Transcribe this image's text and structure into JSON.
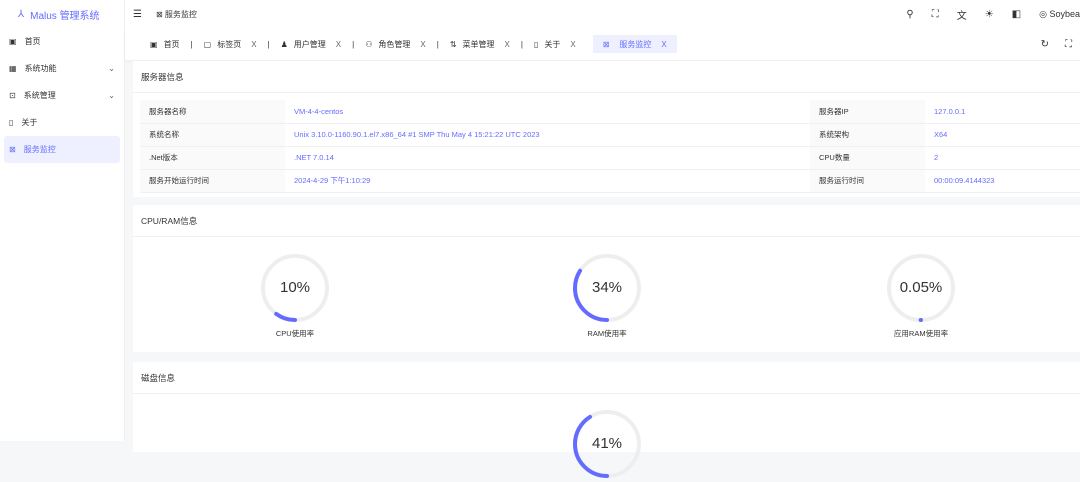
{
  "app": {
    "title": "Malus 管理系统"
  },
  "sidebar": {
    "items": [
      {
        "label": "首页"
      },
      {
        "label": "系统功能"
      },
      {
        "label": "系统管理"
      },
      {
        "label": "关于"
      },
      {
        "label": "服务监控"
      }
    ]
  },
  "header": {
    "breadcrumb": "服务监控",
    "user": "Soybea"
  },
  "tabs": [
    {
      "label": "首页"
    },
    {
      "label": "标签页"
    },
    {
      "label": "用户管理"
    },
    {
      "label": "角色管理"
    },
    {
      "label": "菜单管理"
    },
    {
      "label": "关于"
    },
    {
      "label": "服务监控"
    }
  ],
  "tab_close": "X",
  "server": {
    "title": "服务器信息",
    "rows": [
      {
        "l1": "服务器名称",
        "v1": "VM-4-4-centos",
        "l2": "服务器IP",
        "v2": "127.0.0.1"
      },
      {
        "l1": "系统名称",
        "v1": "Unix 3.10.0-1160.90.1.el7.x86_64 #1 SMP Thu May 4 15:21:22 UTC 2023",
        "l2": "系统架构",
        "v2": "X64"
      },
      {
        "l1": ".Net版本",
        "v1": ".NET 7.0.14",
        "l2": "CPU数量",
        "v2": "2"
      },
      {
        "l1": "服务开始运行时间",
        "v1": "2024-4-29 下午1:10:29",
        "l2": "服务运行时间",
        "v2": "00:00:09.4144323"
      }
    ]
  },
  "cpuram": {
    "title": "CPU/RAM信息",
    "gauges": [
      {
        "value": 10,
        "text": "10%",
        "label": "CPU使用率"
      },
      {
        "value": 34,
        "text": "34%",
        "label": "RAM使用率"
      },
      {
        "value": 0.05,
        "text": "0.05%",
        "label": "应用RAM使用率"
      }
    ]
  },
  "disk": {
    "title": "磁盘信息",
    "gauges": [
      {
        "value": 41,
        "text": "41%"
      }
    ]
  },
  "colors": {
    "accent": "#646cff",
    "track": "#eeeeee"
  }
}
